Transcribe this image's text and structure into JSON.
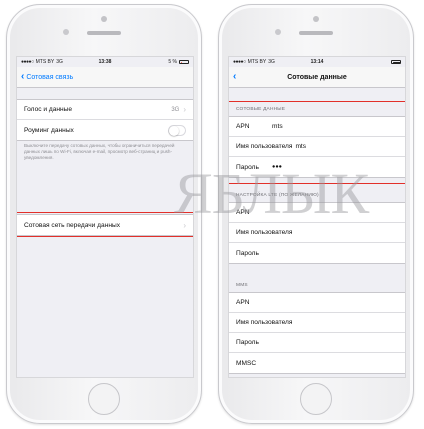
{
  "left_phone": {
    "status": {
      "carrier": "MTS BY",
      "network": "3G",
      "time": "13:38",
      "battery": "5 %"
    },
    "nav": {
      "back_label": "Сотовая связь"
    },
    "rows": {
      "voice_data": {
        "label": "Голос и данные",
        "value": "3G"
      },
      "roaming": {
        "label": "Роуминг данных",
        "toggle_on": false
      }
    },
    "footnote": "Выключите передачу сотовых данных, чтобы ограничиться передачей данных лишь по Wi-Fi, включая e-mail, просмотр веб-страниц и push-уведомления.",
    "cellular_network_row": "Сотовая сеть передачи данных"
  },
  "right_phone": {
    "status": {
      "carrier": "MTS BY",
      "network": "3G",
      "time": "13:14"
    },
    "nav": {
      "title": "Сотовые данные"
    },
    "cellular_section": {
      "header": "СОТОВЫЕ ДАННЫЕ",
      "rows": [
        {
          "label": "APN",
          "value": "mts"
        },
        {
          "label": "Имя пользователя",
          "value": "mts"
        },
        {
          "label": "Пароль",
          "value": "●●●"
        }
      ]
    },
    "lte_section": {
      "header": "НАСТРОЙКА LTE (ПО ЖЕЛАНИЮ)",
      "rows": [
        {
          "label": "APN"
        },
        {
          "label": "Имя пользователя"
        },
        {
          "label": "Пароль"
        }
      ]
    },
    "mms_section": {
      "header": "MMS",
      "rows": [
        {
          "label": "APN"
        },
        {
          "label": "Имя пользователя"
        },
        {
          "label": "Пароль"
        },
        {
          "label": "MMSC"
        }
      ]
    }
  },
  "watermark": "ЯБЛЫК",
  "colors": {
    "ios_blue": "#007aff",
    "highlight_red": "#e2302a",
    "battery_low": "#ff3b30"
  }
}
